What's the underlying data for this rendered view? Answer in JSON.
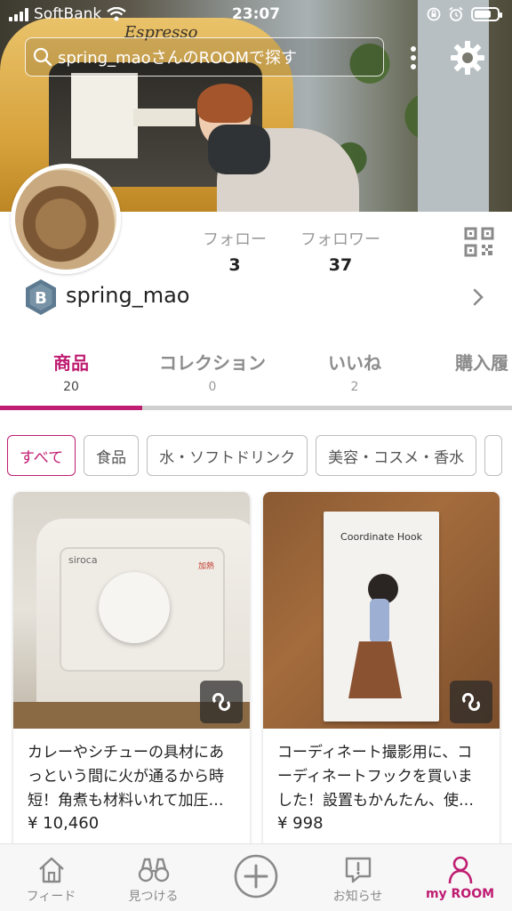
{
  "status_bar": {
    "carrier": "SoftBank",
    "time": "23:07"
  },
  "search": {
    "placeholder": "spring_maoさんのROOMで探す"
  },
  "profile": {
    "username": "spring_mao",
    "badge_letter": "B",
    "follow_label": "フォロー",
    "follow_count": "3",
    "follower_label": "フォロワー",
    "follower_count": "37"
  },
  "tabs": [
    {
      "label": "商品",
      "count": "20"
    },
    {
      "label": "コレクション",
      "count": "0"
    },
    {
      "label": "いいね",
      "count": "2"
    },
    {
      "label": "購入履"
    }
  ],
  "filters": [
    "すべて",
    "食品",
    "水・ソフトドリンク",
    "美容・コスメ・香水"
  ],
  "cover": {
    "sign_text": "Espresso"
  },
  "items": [
    {
      "description": "カレーやシチューの具材にあっという間に火が通るから時短！角煮も材料いれて加圧…",
      "price": "¥ 10,460",
      "brand": "siroca",
      "status_text": "加熱"
    },
    {
      "description": "コーディネート撮影用に、コーディネートフックを買いました！設置もかんたん、使…",
      "price": "¥ 998",
      "box_title": "Coordinate Hook"
    }
  ],
  "bottom_nav": [
    {
      "label": "フィード",
      "icon": "home-icon"
    },
    {
      "label": "見つける",
      "icon": "binoculars-icon"
    },
    {
      "label": "",
      "icon": "plus-circle-icon"
    },
    {
      "label": "お知らせ",
      "icon": "notification-icon"
    },
    {
      "label": "my ROOM",
      "icon": "person-icon"
    }
  ],
  "colors": {
    "accent": "#bf1d72",
    "inactive": "#8a8a8a",
    "badge": "#5d7a91"
  }
}
